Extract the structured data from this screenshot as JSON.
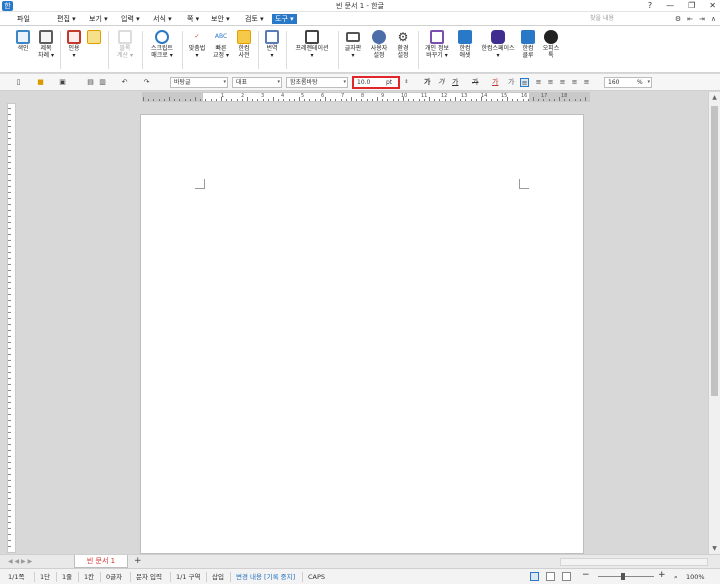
{
  "window": {
    "title": "빈 문서 1 - 한글",
    "logo_glyph": "한",
    "buttons": [
      "?",
      "—",
      "❐",
      "✕"
    ]
  },
  "menu": {
    "items": [
      {
        "label": "파일"
      },
      {
        "label": "편집 ▾"
      },
      {
        "label": "보기 ▾"
      },
      {
        "label": "입력 ▾"
      },
      {
        "label": "서식 ▾"
      },
      {
        "label": "쪽 ▾"
      },
      {
        "label": "보안 ▾"
      },
      {
        "label": "검토 ▾"
      },
      {
        "label": "도구 ▾",
        "active": true
      }
    ],
    "search_placeholder": "찾을 내용",
    "right_icons": [
      "⚙",
      "⇤",
      "⇥",
      "∧"
    ]
  },
  "ribbon": {
    "items": [
      {
        "label": "색인",
        "icon": "index-icon",
        "color": "#3d86c6"
      },
      {
        "label": "제목\n차례 ▾",
        "icon": "toc-icon",
        "color": "#5c5c5c"
      },
      {
        "label": "인용\n▾",
        "icon": "quote-icon",
        "color": "#c0392b"
      },
      {
        "label": "",
        "icon": "style-brush-icon",
        "color": "#e2a000"
      },
      {
        "label": "블록\n계산 ▾",
        "icon": "block-calc-icon",
        "color": "#9a9a9a",
        "disabled": true
      },
      {
        "label": "스크립트\n매크로 ▾",
        "icon": "script-macro-icon",
        "color": "#2a79c9"
      },
      {
        "label": "맞춤법\n▾",
        "icon": "spellcheck-icon",
        "color": "#c0392b"
      },
      {
        "label": "빠른\n교정 ▾",
        "icon": "quick-correct-icon",
        "color": "#2a79c9"
      },
      {
        "label": "한컴\n사전",
        "icon": "dictionary-icon",
        "color": "#e2a000"
      },
      {
        "label": "번역\n▾",
        "icon": "translate-icon",
        "color": "#5b7bb3"
      },
      {
        "label": "프레젠테이션\n▾",
        "icon": "presentation-icon",
        "color": "#444444"
      },
      {
        "label": "글자판\n▾",
        "icon": "keyboard-icon",
        "color": "#555555"
      },
      {
        "label": "사용자\n설정",
        "icon": "user-settings-icon",
        "color": "#4b6ea8"
      },
      {
        "label": "환경\n설정",
        "icon": "gear-icon",
        "color": "#333333"
      },
      {
        "label": "개인 정보\n바꾸기 ▾",
        "icon": "privacy-icon",
        "color": "#7a4fb0"
      },
      {
        "label": "한컴\n애셋",
        "icon": "hancom-asset-icon",
        "color": "#2a79c9"
      },
      {
        "label": "한컴스페이스\n▾",
        "icon": "hancom-space-icon",
        "color": "#3f2d8f"
      },
      {
        "label": "한컴\n클루",
        "icon": "hancom-clue-icon",
        "color": "#2a79c9"
      },
      {
        "label": "오피스\n톡",
        "icon": "office-talk-icon",
        "color": "#222222"
      }
    ]
  },
  "toolbar2": {
    "style": "바탕글",
    "style_label": "대표",
    "font": "함초롬바탕",
    "font_size": "10.0",
    "font_unit": "pt",
    "format_buttons": [
      "가",
      "가",
      "가",
      "가",
      "가",
      "가"
    ],
    "zoom": "160",
    "zoom_unit": "%"
  },
  "ruler": {
    "numbers": [
      "1",
      "2",
      "3",
      "4",
      "5",
      "6",
      "7",
      "8",
      "9",
      "10",
      "11",
      "12",
      "13",
      "14",
      "15",
      "16",
      "17",
      "18",
      "19"
    ]
  },
  "tabs": {
    "document_tab": "빈 문서 1",
    "add_glyph": "+",
    "nav_glyph": "◀ ◀ ▶ ▶"
  },
  "status": {
    "page": "1/1쪽",
    "section": "1단",
    "line": "1줄",
    "column": "1칸",
    "chars": "0글자",
    "mode": "문자 입력",
    "area": "1/1 구역",
    "insert": "삽입",
    "track": "변경 내용 [기록 중지]",
    "caps": "CAPS",
    "zoom": "100%"
  },
  "colors": {
    "accent": "#2a79c9",
    "highlight_border": "#e0262c",
    "tab_text": "#d23030"
  }
}
